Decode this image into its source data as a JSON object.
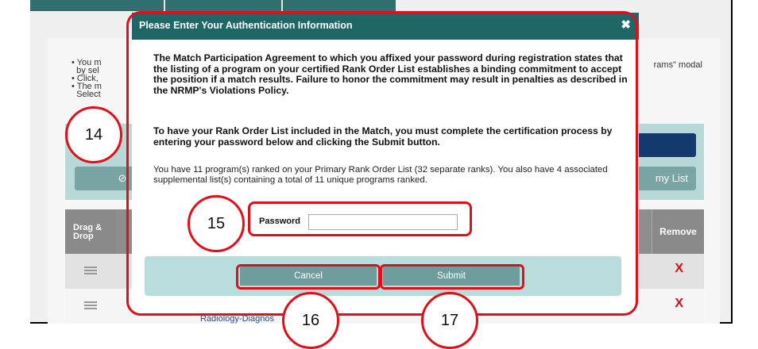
{
  "background": {
    "bullets": [
      "You m",
      "by sel",
      "Click,",
      "The m",
      "Select"
    ],
    "right_text": "rams\" modal",
    "left_button_symbol": "⊘",
    "right_button_text": "my List",
    "table": {
      "col_drag": "Drag & Drop",
      "col_remove": "Remove",
      "remove_symbol": "X",
      "row_link_text": "Radiology-Diagnos"
    }
  },
  "modal": {
    "title": "Please Enter Your Authentication Information",
    "close_symbol": "✖",
    "para1": "The Match Participation Agreement to which you affixed your password during registration states that the listing of a program on your certified Rank Order List establishes a binding commitment to accept the position if a match results. Failure to honor the commitment may result in penalties as described in the NRMP's Violations Policy.",
    "para2": "To have your Rank Order List included in the Match, you must complete the certification process by entering your password below and clicking the Submit button.",
    "para3": "You have 11 program(s) ranked on your Primary Rank Order List (32 separate ranks). You also have 4 associated supplemental list(s) containing a total of 11 unique programs ranked.",
    "password_label": "Password",
    "password_value": "",
    "cancel_label": "Cancel",
    "submit_label": "Submit"
  },
  "callouts": {
    "c14": "14",
    "c15": "15",
    "c16": "16",
    "c17": "17"
  },
  "colors": {
    "header_teal": "#1f6667",
    "annotation_red": "#e0101a",
    "button_teal": "#6f9c9c",
    "footer_light": "#b9dcdc"
  }
}
